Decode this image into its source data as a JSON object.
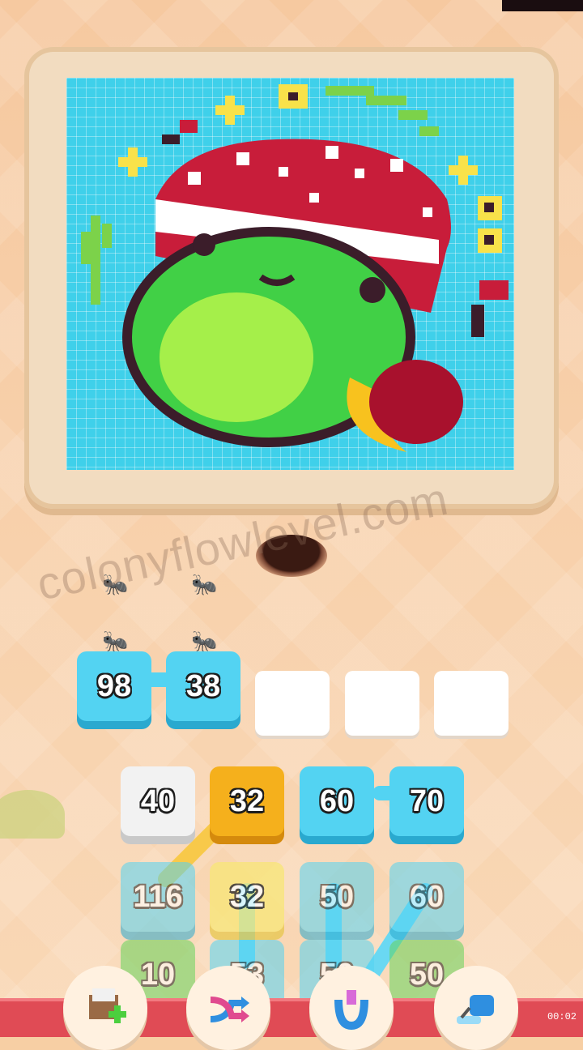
{
  "watermark": "colonyflowlevel.com",
  "artwork": {
    "subject": "frog-with-mushroom-hat-pixel-art",
    "colors": {
      "background": "#3fd0ea",
      "frog": "#41d046",
      "belly": "#a5ef4a",
      "hat": "#c81d3a",
      "spots": "#ffffff",
      "outline": "#3b1d2a",
      "moon": "#f8c21e",
      "sparkle": "#f8e24a",
      "vine": "#7cd24a"
    }
  },
  "queue_slots": [
    {
      "value": "98",
      "state": "filled"
    },
    {
      "value": "38",
      "state": "filled"
    },
    {
      "value": "",
      "state": "empty"
    },
    {
      "value": "",
      "state": "empty"
    },
    {
      "value": "",
      "state": "empty"
    }
  ],
  "board": {
    "row1": [
      {
        "value": "40",
        "color": "white"
      },
      {
        "value": "32",
        "color": "orange"
      },
      {
        "value": "60",
        "color": "blue"
      },
      {
        "value": "70",
        "color": "blue"
      }
    ],
    "row2": [
      {
        "value": "116",
        "color": "blue"
      },
      {
        "value": "32",
        "color": "yellow"
      },
      {
        "value": "50",
        "color": "blue"
      },
      {
        "value": "60",
        "color": "blue"
      }
    ],
    "row3": [
      {
        "value": "10",
        "color": "green"
      },
      {
        "value": "53",
        "color": "blue"
      },
      {
        "value": "50",
        "color": "blue"
      },
      {
        "value": "50",
        "color": "green"
      }
    ]
  },
  "tools": [
    {
      "name": "add-slot-tool",
      "icon": "crate-plus-icon"
    },
    {
      "name": "shuffle-tool",
      "icon": "shuffle-arrows-icon"
    },
    {
      "name": "magnet-tool",
      "icon": "magnet-claw-icon"
    },
    {
      "name": "vacuum-tool",
      "icon": "vacuum-icon"
    }
  ],
  "timer": "00:02"
}
